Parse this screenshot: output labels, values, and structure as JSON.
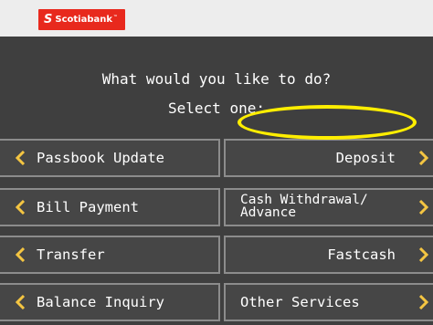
{
  "brand": {
    "name": "Scotiabank",
    "trademark": "™",
    "color": "#e8291d"
  },
  "prompt": {
    "title": "What would you like to do?",
    "subtitle": "Select one:"
  },
  "buttons": {
    "left": [
      "Passbook Update",
      "Bill Payment",
      "Transfer",
      "Balance Inquiry"
    ],
    "right": {
      "deposit": "Deposit",
      "cash_line1": "Cash Withdrawal/",
      "cash_line2": "Advance",
      "fastcash": "Fastcash",
      "other": "Other Services"
    }
  },
  "highlight": {
    "target": "Deposit",
    "color": "#ffee00"
  },
  "icons": {
    "left_arrow": "chevron-left-icon",
    "right_arrow": "chevron-right-icon"
  },
  "colors": {
    "screen": "#3f3f3f",
    "button": "#464646",
    "arrow": "#f4c542"
  }
}
